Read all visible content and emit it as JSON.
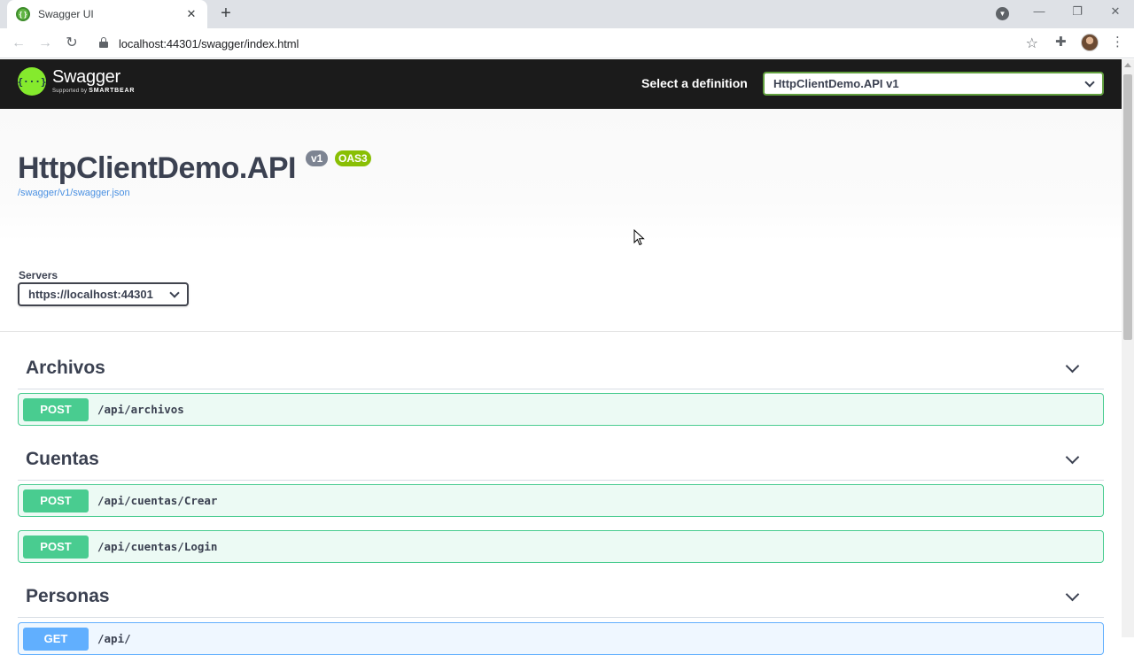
{
  "browser": {
    "tab_title": "Swagger UI",
    "tab_favicon": "{ }",
    "close_glyph": "✕",
    "new_tab_glyph": "+",
    "url": "localhost:44301/swagger/index.html",
    "icons": {
      "back": "←",
      "forward": "→",
      "reload": "↻",
      "star": "☆",
      "extensions": "✚",
      "menu": "⋮",
      "tab_search": "▼",
      "minimize": "—",
      "restore": "❐",
      "close": "✕"
    }
  },
  "topbar": {
    "logo_mark": "{···}",
    "logo_name": "Swagger",
    "logo_sub_prefix": "Supported by ",
    "logo_sub_brand": "SMARTBEAR",
    "definition_label": "Select a definition",
    "definition_value": "HttpClientDemo.API v1"
  },
  "info": {
    "title": "HttpClientDemo.API",
    "version": "v1",
    "oas": "OAS3",
    "spec_link": "/swagger/v1/swagger.json"
  },
  "servers": {
    "label": "Servers",
    "selected": "https://localhost:44301"
  },
  "tags": [
    {
      "name": "Archivos"
    },
    {
      "name": "Cuentas"
    },
    {
      "name": "Personas"
    }
  ],
  "operations": [
    {
      "method": "POST",
      "path": "/api/archivos"
    },
    {
      "method": "POST",
      "path": "/api/cuentas/Crear"
    },
    {
      "method": "POST",
      "path": "/api/cuentas/Login"
    },
    {
      "method": "GET",
      "path": "/api/"
    }
  ],
  "colors": {
    "post": "#49cc90",
    "get": "#61affe",
    "topbar": "#1b1b1b",
    "swagger_green": "#85ea2d"
  }
}
